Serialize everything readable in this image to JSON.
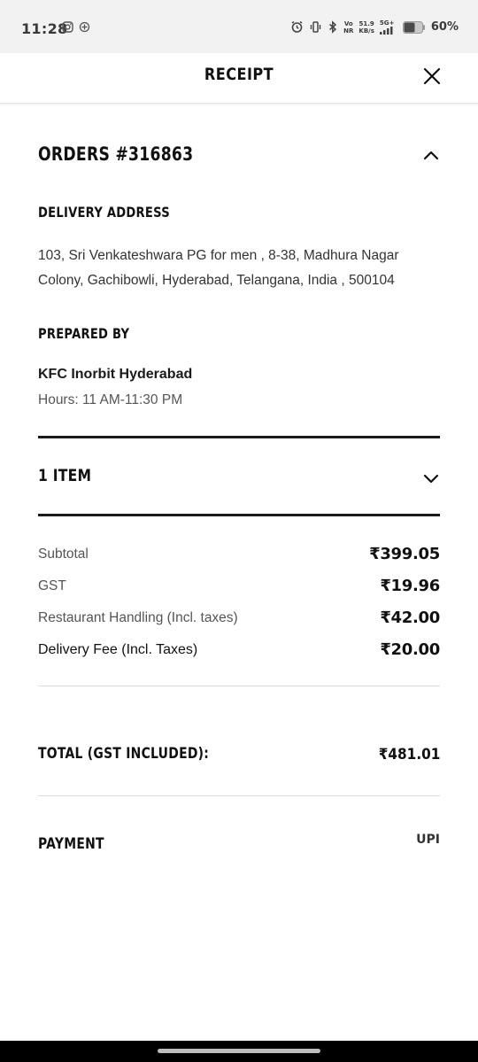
{
  "status_bar": {
    "time": "11:28",
    "network_speed_value": "51.9",
    "network_speed_unit": "KB/s",
    "vo_label": "Vo",
    "nr_label": "NR",
    "network_type": "5G+",
    "battery_percent": "60%",
    "battery_level": 0.6
  },
  "header": {
    "title": "RECEIPT"
  },
  "order": {
    "title": "ORDERS #316863",
    "expanded": true
  },
  "delivery": {
    "label": "DELIVERY ADDRESS",
    "address": "103, Sri Venkateshwara PG for men , 8-38, Madhura Nagar Colony, Gachibowli, Hyderabad, Telangana, India , 500104"
  },
  "prepared": {
    "label": "PREPARED BY",
    "restaurant": "KFC Inorbit Hyderabad",
    "hours": "Hours: 11 AM-11:30 PM"
  },
  "items": {
    "title": "1 ITEM",
    "expanded": false
  },
  "fees": [
    {
      "label": "Subtotal",
      "value": "₹399.05"
    },
    {
      "label": "GST",
      "value": "₹19.96"
    },
    {
      "label": "Restaurant Handling (Incl. taxes)",
      "value": "₹42.00"
    },
    {
      "label": "Delivery Fee (Incl. Taxes)",
      "value": "₹20.00"
    }
  ],
  "total": {
    "label": "TOTAL (GST INCLUDED):",
    "value": "₹481.01"
  },
  "payment": {
    "label": "PAYMENT",
    "method": "UPI"
  },
  "colors": {
    "text_primary": "#111111",
    "text_secondary": "#555555",
    "divider": "#dcdcdc",
    "status_bar_bg": "#f2f2f2",
    "nav_bar_bg": "#000000"
  }
}
